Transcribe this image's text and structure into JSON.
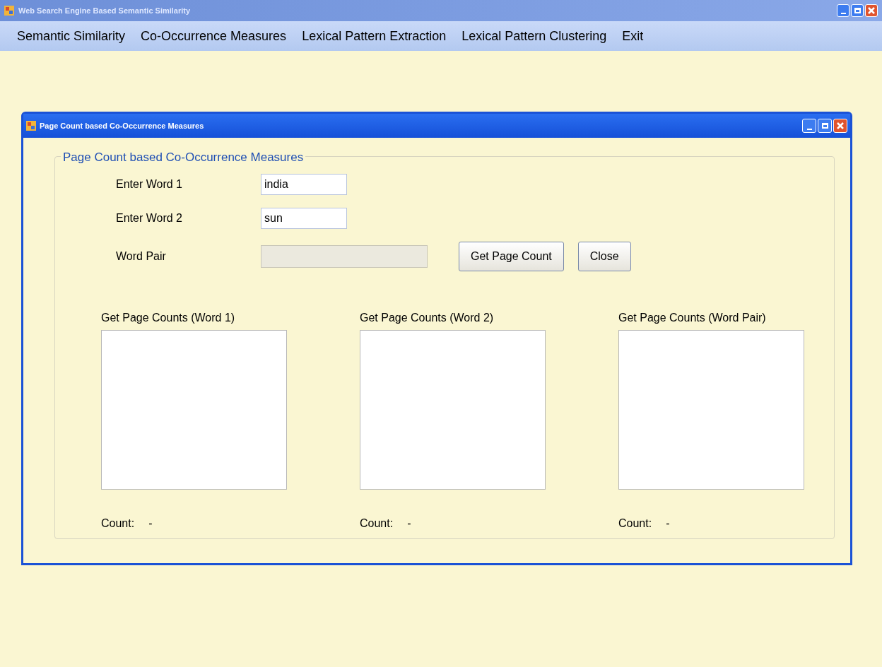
{
  "window": {
    "title": "Web Search Engine Based Semantic Similarity"
  },
  "menu": [
    "Semantic Similarity",
    "Co-Occurrence Measures",
    "Lexical Pattern Extraction",
    "Lexical Pattern Clustering",
    "Exit"
  ],
  "child_window": {
    "title": "Page Count based Co-Occurrence Measures",
    "group": {
      "title": "Page Count based Co-Occurrence Measures",
      "fields": [
        {
          "label": "Enter Word 1",
          "value": "india",
          "disabled": false
        },
        {
          "label": "Enter Word 2",
          "value": "sun",
          "disabled": false
        },
        {
          "label": "Word Pair",
          "disabled": true
        }
      ],
      "buttons": [
        "Get Page Count",
        "Close"
      ],
      "lists": [
        {
          "title": "Get Page Counts (Word 1)",
          "count_label": "Count:",
          "count": "-"
        },
        {
          "title": "Get Page Counts (Word 2)",
          "count_label": "Count:",
          "count": "-"
        },
        {
          "title": "Get Page Counts (Word Pair)",
          "count_label": "Count:",
          "count": "-"
        }
      ]
    }
  }
}
